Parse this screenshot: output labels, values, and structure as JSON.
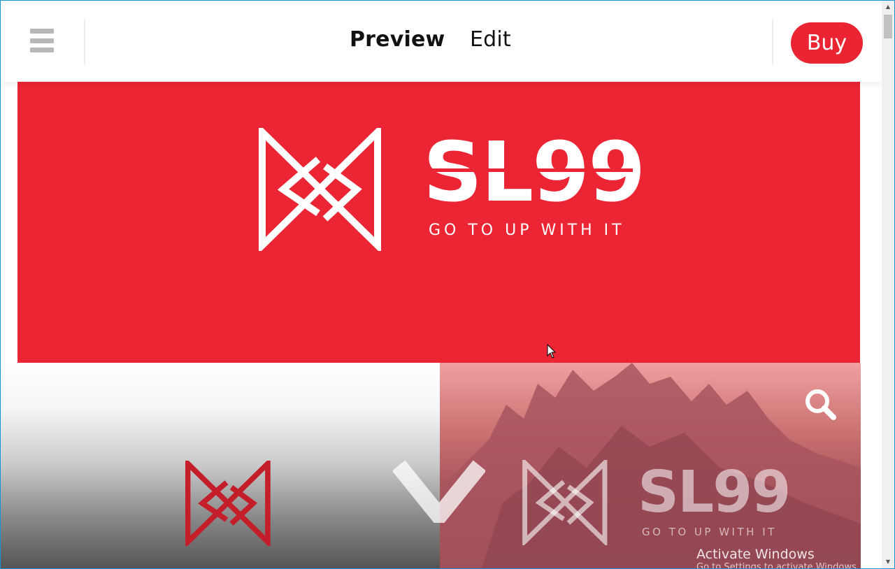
{
  "toolbar": {
    "menu_icon": "hamburger-menu-icon",
    "tabs": [
      {
        "label": "Preview",
        "active": true
      },
      {
        "label": "Edit",
        "active": false
      }
    ],
    "buy_label": "Buy"
  },
  "hero": {
    "brand_text": "SL99",
    "tagline": "GO TO UP WITH IT",
    "background_color": "#ec2534"
  },
  "thumbnails": {
    "right": {
      "brand_text": "SL99",
      "tagline": "GO TO UP WITH IT",
      "zoom_icon": "search-icon"
    }
  },
  "watermark": {
    "title": "Activate Windows",
    "subtitle": "Go to Settings to activate Windows."
  },
  "colors": {
    "accent": "#ea2433",
    "divider": "#eeeeee",
    "frame": "#1e90d8"
  }
}
